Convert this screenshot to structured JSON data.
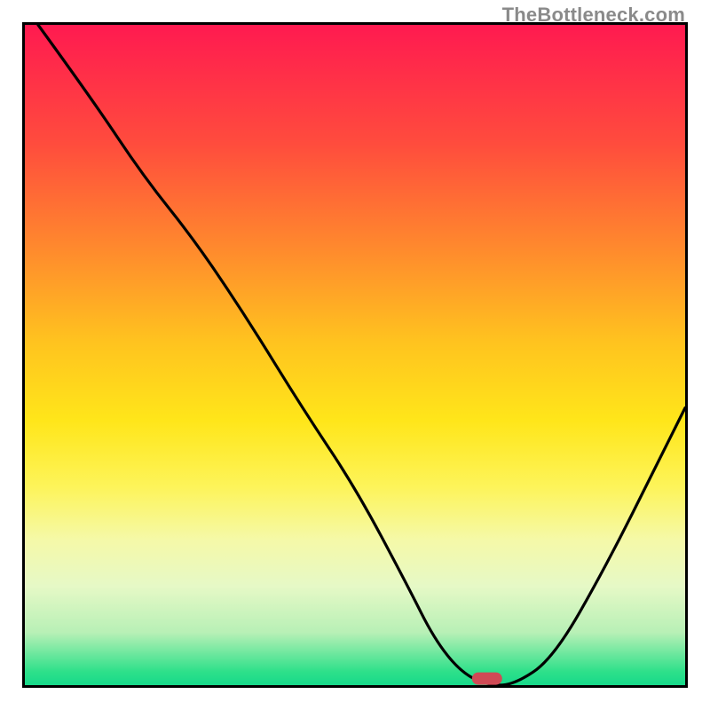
{
  "watermark": "TheBottleneck.com",
  "chart_data": {
    "type": "line",
    "title": "",
    "xlabel": "",
    "ylabel": "",
    "xlim": [
      0,
      100
    ],
    "ylim": [
      0,
      100
    ],
    "grid": false,
    "series": [
      {
        "name": "curve",
        "color": "#000000",
        "x": [
          2,
          10,
          18,
          26,
          34,
          42,
          50,
          58,
          62,
          66,
          70,
          74,
          80,
          88,
          96,
          100
        ],
        "y": [
          100,
          89,
          77,
          67,
          55,
          42,
          30,
          15,
          7,
          2,
          0,
          0,
          4,
          18,
          34,
          42
        ]
      }
    ],
    "marker": {
      "shape": "pill",
      "x": 70,
      "y": 1,
      "color": "#d04a55"
    },
    "background": "red-yellow-green-gradient"
  }
}
